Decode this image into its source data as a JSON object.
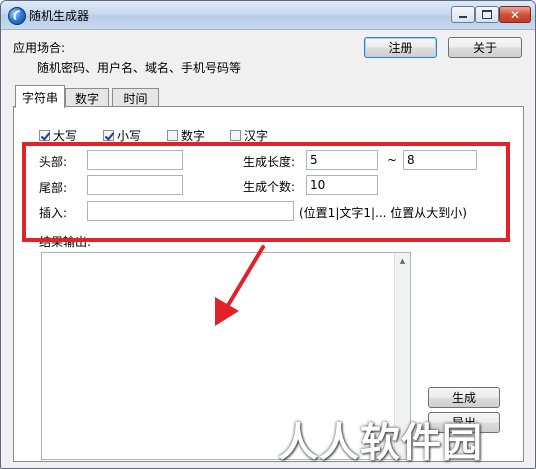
{
  "window": {
    "title": "随机生成器"
  },
  "header": {
    "usage_label": "应用场合:",
    "usage_text": "随机密码、用户名、域名、手机号码等",
    "register_label": "注册",
    "about_label": "关于"
  },
  "tabs": [
    {
      "label": "字符串",
      "active": true
    },
    {
      "label": "数字",
      "active": false
    },
    {
      "label": "时间",
      "active": false
    }
  ],
  "options": {
    "uppercase": {
      "label": "大写",
      "checked": true
    },
    "lowercase": {
      "label": "小写",
      "checked": true
    },
    "digits": {
      "label": "数字",
      "checked": false
    },
    "chinese": {
      "label": "汉字",
      "checked": false
    }
  },
  "form": {
    "head_label": "头部:",
    "head_value": "",
    "tail_label": "尾部:",
    "tail_value": "",
    "insert_label": "插入:",
    "insert_value": "",
    "insert_hint": "(位置1|文字1|... 位置从大到小)",
    "length_label": "生成长度:",
    "length_min": "5",
    "length_sep": "~",
    "length_max": "8",
    "count_label": "生成个数:",
    "count_value": "10"
  },
  "output": {
    "label": "结果输出:",
    "value": ""
  },
  "actions": {
    "generate_label": "生成",
    "export_label": "导出"
  },
  "watermark": "人人软件园",
  "colors": {
    "annotation": "#e0232b",
    "titlebar": "#c8d9ee",
    "close": "#c23a24"
  }
}
